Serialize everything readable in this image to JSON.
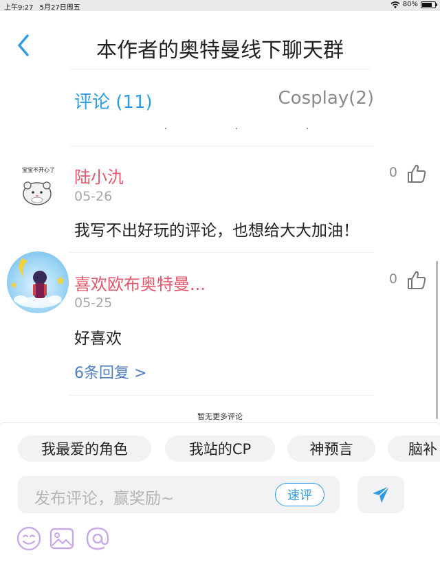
{
  "status_bar": {
    "time": "上午9:27",
    "date": "5月27日周五",
    "battery": "80%",
    "battery_level": 0.8
  },
  "header": {
    "title": "本作者的奥特曼线下聊天群"
  },
  "tabs": [
    {
      "label": "评论 (11)",
      "active": true
    },
    {
      "label": "Cosplay(2)",
      "active": false
    }
  ],
  "comments": [
    {
      "avatar_caption": "宝宝不开心了",
      "username": "陆小氿",
      "date": "05-26",
      "text": "我写不出好玩的评论，也想给大大加油！",
      "likes": "0"
    },
    {
      "username": "喜欢欧布奥特曼...",
      "date": "05-25",
      "text": "好喜欢",
      "replies": "6条回复 >",
      "likes": "0"
    }
  ],
  "footer_note": "暂无更多评论",
  "tag_chips": [
    "我最爱的角色",
    "我站的CP",
    "神预言",
    "脑补"
  ],
  "input": {
    "placeholder": "发布评论，赢奖励~",
    "quick_label": "速评"
  },
  "colors": {
    "accent": "#2e9ce0",
    "username": "#e0566a",
    "reply_link": "#4f7fc7",
    "toolbar_icon": "#c9a8e8"
  },
  "icons": [
    "wifi-icon",
    "battery-icon",
    "back-chevron-icon",
    "thumbs-up-icon",
    "send-icon",
    "emoji-icon",
    "image-icon",
    "at-mention-icon"
  ]
}
